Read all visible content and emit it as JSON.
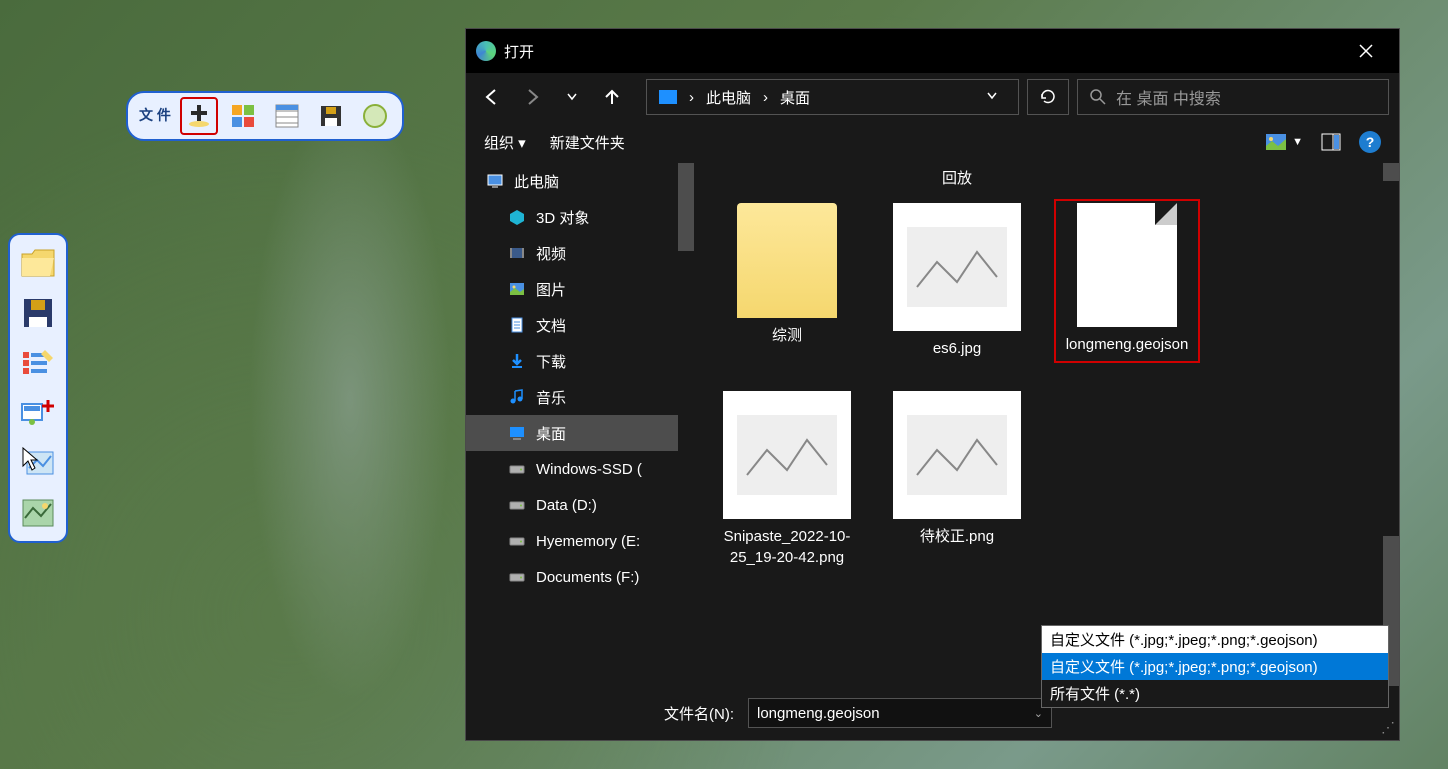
{
  "top_toolbar": {
    "file_label": "文\n件"
  },
  "dialog": {
    "title": "打开",
    "breadcrumb": [
      "此电脑",
      "桌面"
    ],
    "search_placeholder": "在 桌面 中搜索",
    "organize": "组织",
    "new_folder": "新建文件夹",
    "header_label": "回放",
    "filename_label": "文件名(N):",
    "filename_value": "longmeng.geojson"
  },
  "tree": {
    "items": [
      {
        "label": "此电脑",
        "indent": 0,
        "selected": false,
        "icon": "pc"
      },
      {
        "label": "3D 对象",
        "indent": 1,
        "selected": false,
        "icon": "3d"
      },
      {
        "label": "视频",
        "indent": 1,
        "selected": false,
        "icon": "video"
      },
      {
        "label": "图片",
        "indent": 1,
        "selected": false,
        "icon": "image"
      },
      {
        "label": "文档",
        "indent": 1,
        "selected": false,
        "icon": "doc"
      },
      {
        "label": "下载",
        "indent": 1,
        "selected": false,
        "icon": "download"
      },
      {
        "label": "音乐",
        "indent": 1,
        "selected": false,
        "icon": "music"
      },
      {
        "label": "桌面",
        "indent": 1,
        "selected": true,
        "icon": "desktop"
      },
      {
        "label": "Windows-SSD (",
        "indent": 1,
        "selected": false,
        "icon": "drive"
      },
      {
        "label": "Data (D:)",
        "indent": 1,
        "selected": false,
        "icon": "drive"
      },
      {
        "label": "Hyememory (E:",
        "indent": 1,
        "selected": false,
        "icon": "drive"
      },
      {
        "label": "Documents (F:)",
        "indent": 1,
        "selected": false,
        "icon": "drive"
      }
    ]
  },
  "files": [
    {
      "name": "综测",
      "type": "folder",
      "selected": false
    },
    {
      "name": "es6.jpg",
      "type": "image",
      "selected": false
    },
    {
      "name": "longmeng.geojson",
      "type": "doc",
      "selected": true
    },
    {
      "name": "Snipaste_2022-10-25_19-20-42.png",
      "type": "image",
      "selected": false
    },
    {
      "name": "待校正.png",
      "type": "image",
      "selected": false
    }
  ],
  "filter": {
    "current": "自定义文件 (*.jpg;*.jpeg;*.png;*.geojson)",
    "options": [
      "自定义文件 (*.jpg;*.jpeg;*.png;*.geojson)",
      "所有文件 (*.*)"
    ]
  }
}
